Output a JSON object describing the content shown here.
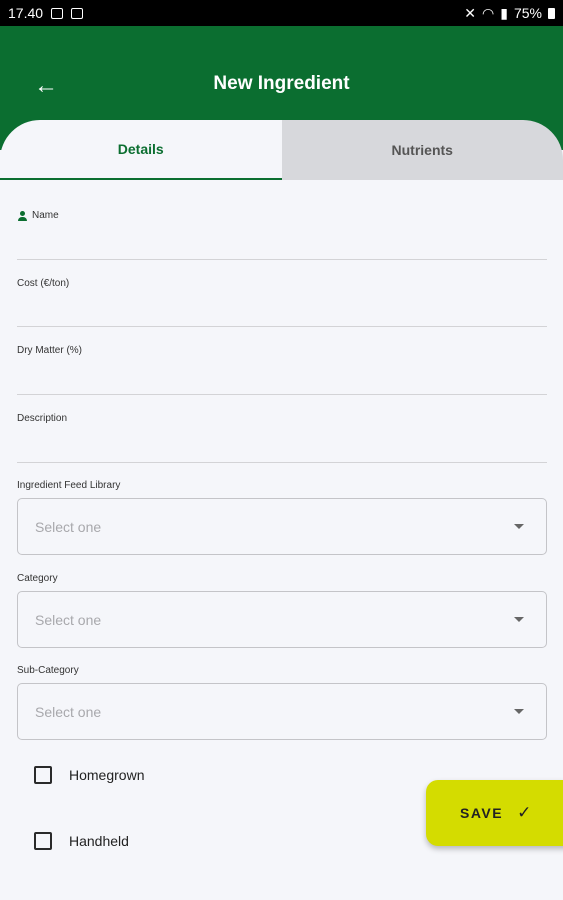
{
  "status_bar": {
    "time": "17.40",
    "battery": "75%"
  },
  "appbar": {
    "title": "New Ingredient",
    "back_icon": "arrow-left-icon"
  },
  "tabs": [
    {
      "label": "Details",
      "active": true
    },
    {
      "label": "Nutrients",
      "active": false
    }
  ],
  "fields": [
    {
      "label": "Name"
    },
    {
      "label": "Cost (€/ton)"
    },
    {
      "label": "Dry Matter (%)"
    },
    {
      "label": "Description"
    }
  ],
  "selects": [
    {
      "label": "Ingredient Feed Library",
      "placeholder": "Select one"
    },
    {
      "label": "Category",
      "placeholder": "Select one"
    },
    {
      "label": "Sub-Category",
      "placeholder": "Select one"
    }
  ],
  "checkboxes": [
    {
      "label": "Homegrown",
      "checked": false
    },
    {
      "label": "Handheld",
      "checked": false
    }
  ],
  "save_button": {
    "label": "SAVE"
  },
  "colors": {
    "primary": "#0b6e30",
    "accent": "#d4dc00",
    "background": "#f5f6fa",
    "tab_inactive": "#d7d8dc"
  }
}
